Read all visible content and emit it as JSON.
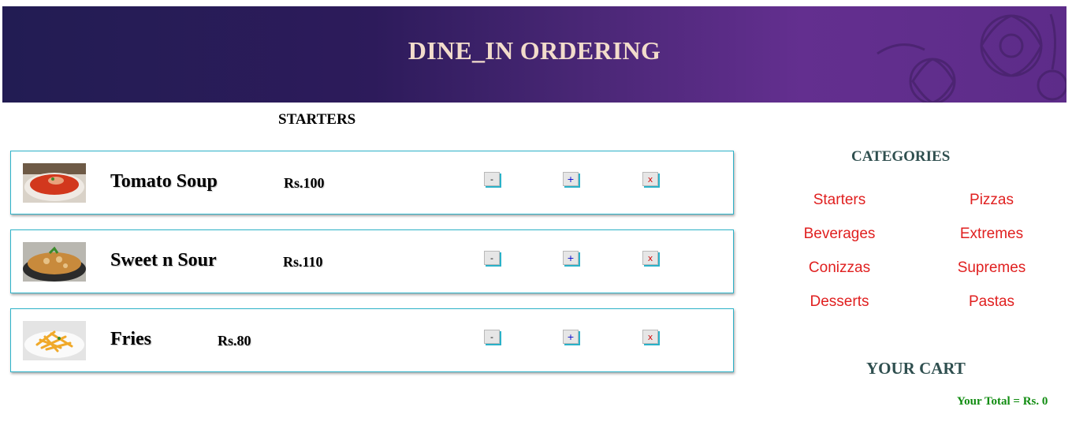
{
  "header": {
    "title": "DINE_IN ORDERING"
  },
  "menu": {
    "section_title": "STARTERS",
    "items": [
      {
        "name": "Tomato Soup",
        "price": "Rs.100",
        "image": "tomato-soup-photo"
      },
      {
        "name": "Sweet n Sour",
        "price": "Rs.110",
        "image": "sweet-n-sour-photo"
      },
      {
        "name": "Fries",
        "price": "Rs.80",
        "image": "fries-photo"
      }
    ],
    "buttons": {
      "decrease": "-",
      "increase": "+",
      "remove": "x"
    }
  },
  "categories": {
    "title": "CATEGORIES",
    "items": [
      "Starters",
      "Pizzas",
      "Beverages",
      "Extremes",
      "Conizzas",
      "Supremes",
      "Desserts",
      "Pastas"
    ]
  },
  "cart": {
    "title": "YOUR CART",
    "total": "Your Total = Rs. 0"
  },
  "colors": {
    "header_dark": "#221c53",
    "header_light": "#632f8f",
    "title_text": "#f2dccb",
    "card_border": "#2db3c9",
    "category_link": "#e02020",
    "heading_slate": "#2f4f4f",
    "total_green": "#118c11"
  }
}
